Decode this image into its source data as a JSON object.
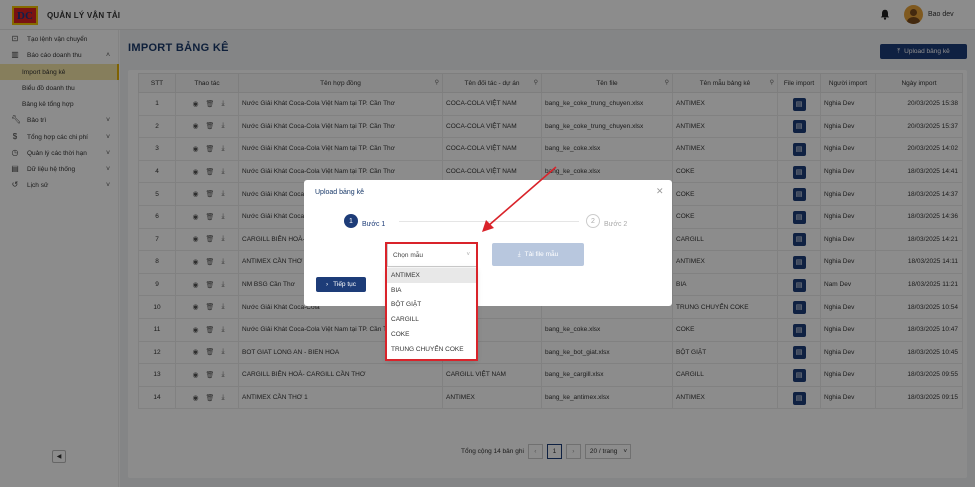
{
  "app": {
    "title": "QUẢN LÝ VẬN TẢI",
    "logo_text": "DC",
    "user": "Bao dev",
    "bell": "bell-icon"
  },
  "sidebar": {
    "items": [
      {
        "label": "Tạo lệnh vận chuyển",
        "icon": "route-icon"
      },
      {
        "label": "Báo cáo doanh thu",
        "icon": "chart-icon"
      },
      {
        "label": "Import bảng kê"
      },
      {
        "label": "Biểu đồ doanh thu"
      },
      {
        "label": "Bảng kê tổng hợp"
      },
      {
        "label": "Bảo trì",
        "icon": "wrench-icon"
      },
      {
        "label": "Tổng hợp các chi phí",
        "icon": "dollar-icon"
      },
      {
        "label": "Quản lý các thời hạn",
        "icon": "clock-icon"
      },
      {
        "label": "Dữ liệu hệ thống",
        "icon": "database-icon"
      },
      {
        "label": "Lịch sử",
        "icon": "history-icon"
      }
    ]
  },
  "page": {
    "title": "IMPORT BẢNG KÊ",
    "upload_label": "Upload bảng kê"
  },
  "table": {
    "headers": [
      "STT",
      "Thao tác",
      "Tên hợp đồng",
      "Tên đối tác - dự án",
      "Tên file",
      "Tên mẫu bảng kê",
      "File import",
      "Người import",
      "Ngày import"
    ],
    "rows": [
      [
        "1",
        "Nước Giải Khát Coca-Cola Việt Nam tại TP. Cần Thơ",
        "COCA-COLA VIỆT NAM",
        "bang_ke_coke_trung_chuyen.xlsx",
        "ANTIMEX",
        "Nghia Dev",
        "20/03/2025 15:38"
      ],
      [
        "2",
        "Nước Giải Khát Coca-Cola Việt Nam tại TP. Cần Thơ",
        "COCA-COLA VIỆT NAM",
        "bang_ke_coke_trung_chuyen.xlsx",
        "ANTIMEX",
        "Nghia Dev",
        "20/03/2025 15:37"
      ],
      [
        "3",
        "Nước Giải Khát Coca-Cola Việt Nam tại TP. Cần Thơ",
        "COCA-COLA VIỆT NAM",
        "bang_ke_coke.xlsx",
        "ANTIMEX",
        "Nghia Dev",
        "20/03/2025 14:02"
      ],
      [
        "4",
        "Nước Giải Khát Coca-Cola Việt Nam tại TP. Cần Thơ",
        "COCA-COLA VIỆT NAM",
        "bang_ke_coke.xlsx",
        "COKE",
        "Nghia Dev",
        "18/03/2025 14:41"
      ],
      [
        "5",
        "Nước Giải Khát Coca-Cola",
        "",
        "",
        "COKE",
        "Nghia Dev",
        "18/03/2025 14:37"
      ],
      [
        "6",
        "Nước Giải Khát Coca-Cola",
        "",
        "",
        "COKE",
        "Nghia Dev",
        "18/03/2025 14:36"
      ],
      [
        "7",
        "CARGILL BIÊN HOÀ- CAR",
        "",
        "",
        "CARGILL",
        "Nghia Dev",
        "18/03/2025 14:21"
      ],
      [
        "8",
        "ANTIMEX CẦN THƠ 1",
        "",
        "",
        "ANTIMEX",
        "Nghia Dev",
        "18/03/2025 14:11"
      ],
      [
        "9",
        "NM BSG Cần Thơ",
        "",
        "",
        "BIA",
        "Nam Dev",
        "18/03/2025 11:21"
      ],
      [
        "10",
        "Nước Giải Khát Coca-Cola",
        "",
        "",
        "TRUNG CHUYỂN COKE",
        "Nghia Dev",
        "18/03/2025 10:54"
      ],
      [
        "11",
        "Nước Giải Khát Coca-Cola Việt Nam tại TP. Cần Thơ",
        "",
        "bang_ke_coke.xlsx",
        "COKE",
        "Nghia Dev",
        "18/03/2025 10:47"
      ],
      [
        "12",
        "BOT GIAT LONG AN - BIEN HOA",
        "G AN",
        "bang_ke_bot_giat.xlsx",
        "BỘT GIẶT",
        "Nghia Dev",
        "18/03/2025 10:45"
      ],
      [
        "13",
        "CARGILL BIÊN HOÀ- CARGILL CẦN THƠ",
        "CARGILL VIỆT NAM",
        "bang_ke_cargill.xlsx",
        "CARGILL",
        "Nghia Dev",
        "18/03/2025 09:55"
      ],
      [
        "14",
        "ANTIMEX CẦN THƠ 1",
        "ANTIMEX",
        "bang_ke_antimex.xlsx",
        "ANTIMEX",
        "Nghia Dev",
        "18/03/2025 09:15"
      ]
    ]
  },
  "pager": {
    "total": "Tổng cộng 14 bản ghi",
    "page": "1",
    "size": "20 / trang"
  },
  "modal": {
    "title": "Upload bảng kê",
    "step1_num": "1",
    "step1": "Bước 1",
    "step2_num": "2",
    "step2": "Bước 2",
    "select_placeholder": "Chọn mẫu",
    "download_label": "Tải file mẫu",
    "next_label": "Tiếp tục",
    "options": [
      "ANTIMEX",
      "BIA",
      "BỘT GIẶT",
      "CARGILL",
      "COKE",
      "TRUNG CHUYỂN COKE"
    ]
  },
  "colors": {
    "primary": "#1d3c78",
    "annotation": "#d9232a",
    "active": "#f5e6a8"
  }
}
